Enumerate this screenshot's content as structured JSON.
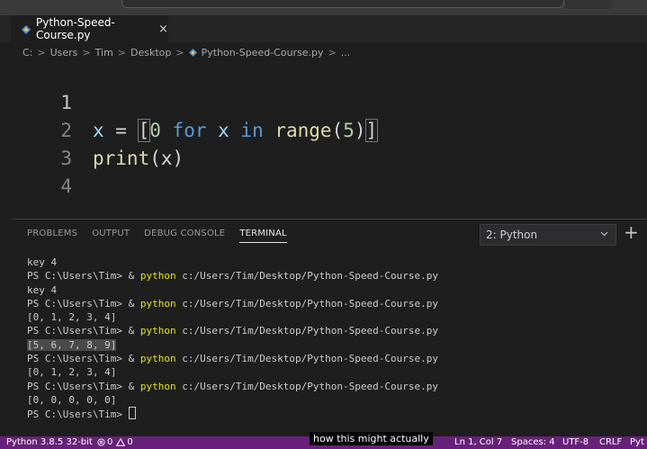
{
  "tab": {
    "filename": "Python-Speed-Course.py",
    "close": "×"
  },
  "breadcrumb": [
    "C:",
    "Users",
    "Tim",
    "Desktop",
    "Python-Speed-Course.py",
    "..."
  ],
  "breadcrumb_sep": ">",
  "editor": {
    "lines": [
      {
        "num": "1",
        "tokens": [
          "x",
          " = ",
          "[",
          "0",
          " for ",
          "x",
          " in ",
          "range",
          "(",
          "5",
          ")",
          "]"
        ]
      },
      {
        "num": "2",
        "tokens": [
          "print",
          "(x)"
        ]
      },
      {
        "num": "3"
      },
      {
        "num": "4"
      }
    ]
  },
  "panel": {
    "tabs": [
      "PROBLEMS",
      "OUTPUT",
      "DEBUG CONSOLE",
      "TERMINAL"
    ],
    "active_tab": "TERMINAL",
    "terminal_select": "2: Python",
    "add_terminal": "+"
  },
  "terminal": {
    "prompt": "PS C:\\Users\\Tim> & ",
    "cmd_name": "python",
    "cmd_arg": " c:/Users/Tim/Desktop/Python-Speed-Course.py",
    "output_1": "key 4",
    "output_2": "key 4",
    "output_3": "[0, 1, 2, 3, 4]",
    "output_4": "[5, 6, 7, 8, 9]",
    "output_5": "[0, 1, 2, 3, 4]",
    "output_6": "[0, 0, 0, 0, 0]",
    "final_prompt": "PS C:\\Users\\Tim> "
  },
  "status": {
    "interpreter": "Python 3.8.5 32-bit",
    "errors": "0",
    "warnings": "0",
    "position": "Ln 1, Col 7",
    "spaces": "Spaces: 4",
    "encoding": "UTF-8",
    "eol": "CRLF",
    "language": "Pyt"
  },
  "caption": "how this might actually",
  "colors": {
    "statusbar": "#68217a",
    "keyword": "#569cd6",
    "function": "#dcdcaa",
    "terminal_cmd": "#e5e510"
  }
}
